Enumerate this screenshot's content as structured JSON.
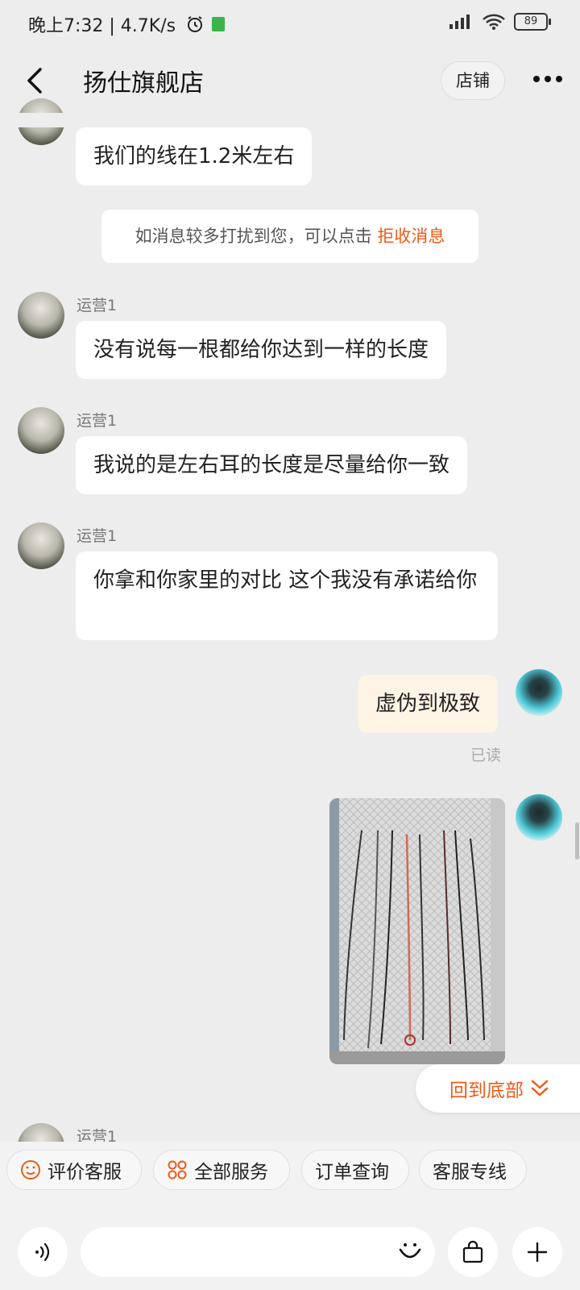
{
  "status_bar": {
    "time": "晚上7:32 | 4.7K/s",
    "battery": "89"
  },
  "header": {
    "title": "扬仕旗舰店",
    "shop_button": "店铺"
  },
  "messages": [
    {
      "text": "我们的线在1.2米左右"
    },
    {
      "sender": "运营1",
      "text": "没有说每一根都给你达到一样的长度"
    },
    {
      "sender": "运营1",
      "text": "我说的是左右耳的长度是尽量给你一致"
    },
    {
      "sender": "运营1",
      "text": "你拿和你家里的对比 这个我没有承诺给你"
    },
    {
      "text": "虚伪到极致",
      "read_status": "已读"
    },
    {
      "sender": "运营1"
    }
  ],
  "notice": {
    "text": "如消息较多打扰到您，可以点击 ",
    "link": "拒收消息"
  },
  "back_to_bottom": "回到底部",
  "quick_actions": [
    "评价客服",
    "全部服务",
    "订单查询",
    "客服专线"
  ],
  "colors": {
    "accent": "#ef5a18",
    "background": "#ededed",
    "my_bubble": "#fdf4e5"
  }
}
